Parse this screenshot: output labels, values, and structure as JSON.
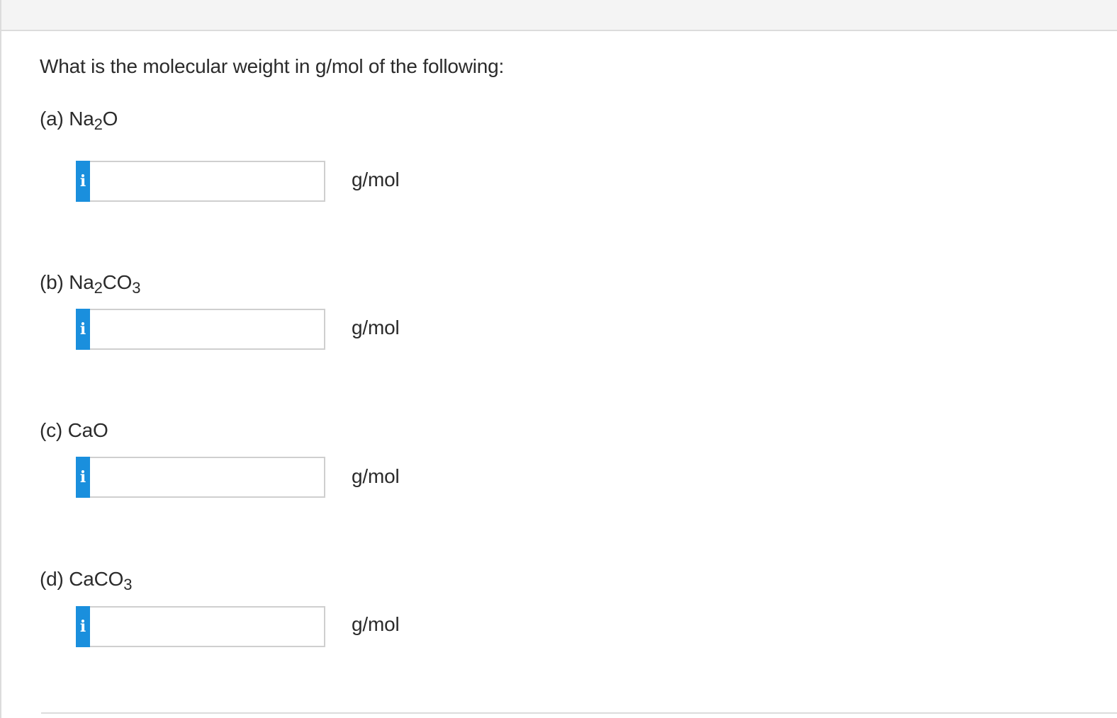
{
  "question": "What is the molecular weight in g/mol of the following:",
  "parts": [
    {
      "prefix": "(a) ",
      "formula": [
        [
          "Na",
          ""
        ],
        [
          "2",
          "sub"
        ],
        [
          "O",
          ""
        ]
      ],
      "value": "",
      "unit": "g/mol"
    },
    {
      "prefix": "(b) ",
      "formula": [
        [
          "Na",
          ""
        ],
        [
          "2",
          "sub"
        ],
        [
          "CO",
          ""
        ],
        [
          "3",
          "sub"
        ]
      ],
      "value": "",
      "unit": "g/mol"
    },
    {
      "prefix": "(c) ",
      "formula": [
        [
          "CaO",
          ""
        ]
      ],
      "value": "",
      "unit": "g/mol"
    },
    {
      "prefix": "(d) ",
      "formula": [
        [
          "CaCO",
          ""
        ],
        [
          "3",
          "sub"
        ]
      ],
      "value": "",
      "unit": "g/mol"
    }
  ],
  "info_button_label": "i",
  "colors": {
    "info_button": "#1a8fdd",
    "border": "#cfcfcf",
    "top_bar": "#f4f4f4"
  }
}
